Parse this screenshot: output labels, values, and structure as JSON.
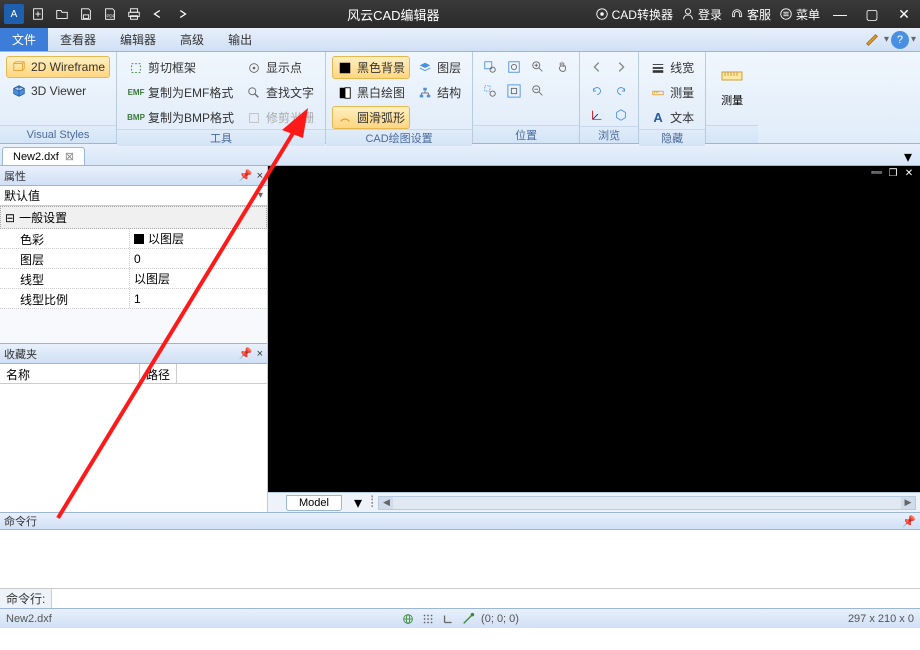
{
  "titlebar": {
    "title": "风云CAD编辑器",
    "converter": "CAD转换器",
    "login": "登录",
    "support": "客服",
    "menu": "菜单"
  },
  "menu": {
    "file": "文件",
    "viewer": "查看器",
    "editor": "编辑器",
    "advanced": "高级",
    "output": "输出"
  },
  "ribbon": {
    "visual_styles": {
      "wireframe": "2D Wireframe",
      "viewer3d": "3D Viewer",
      "label": "Visual Styles"
    },
    "tools": {
      "clip_frame": "剪切框架",
      "copy_emf": "复制为EMF格式",
      "copy_bmp": "复制为BMP格式",
      "show_point": "显示点",
      "find_text": "查找文字",
      "trim_raster": "修剪光栅",
      "label": "工具"
    },
    "cad_settings": {
      "black_bg": "黑色背景",
      "bw_draw": "黑白绘图",
      "smooth_arc": "圆滑弧形",
      "layers": "图层",
      "structure": "结构",
      "label": "CAD绘图设置"
    },
    "position": {
      "label": "位置"
    },
    "browse": {
      "label": "浏览"
    },
    "hide": {
      "line_weight": "线宽",
      "measure": "测量",
      "text": "文本",
      "label": "隐藏"
    },
    "measure_big": "测量"
  },
  "doctab": {
    "name": "New2.dxf"
  },
  "properties": {
    "title": "属性",
    "defaults": "默认值",
    "section_general": "一般设置",
    "rows": [
      {
        "key": "色彩",
        "val": "以图层",
        "swatch": true
      },
      {
        "key": "图层",
        "val": "0"
      },
      {
        "key": "线型",
        "val": "以图层"
      },
      {
        "key": "线型比例",
        "val": "1"
      }
    ]
  },
  "favorites": {
    "title": "收藏夹",
    "col_name": "名称",
    "col_path": "路径"
  },
  "model_tab": "Model",
  "cmdline": {
    "title": "命令行",
    "prompt": "命令行:"
  },
  "statusbar": {
    "file": "New2.dxf",
    "coords": "(0; 0; 0)",
    "dims": "297 x 210 x 0"
  }
}
